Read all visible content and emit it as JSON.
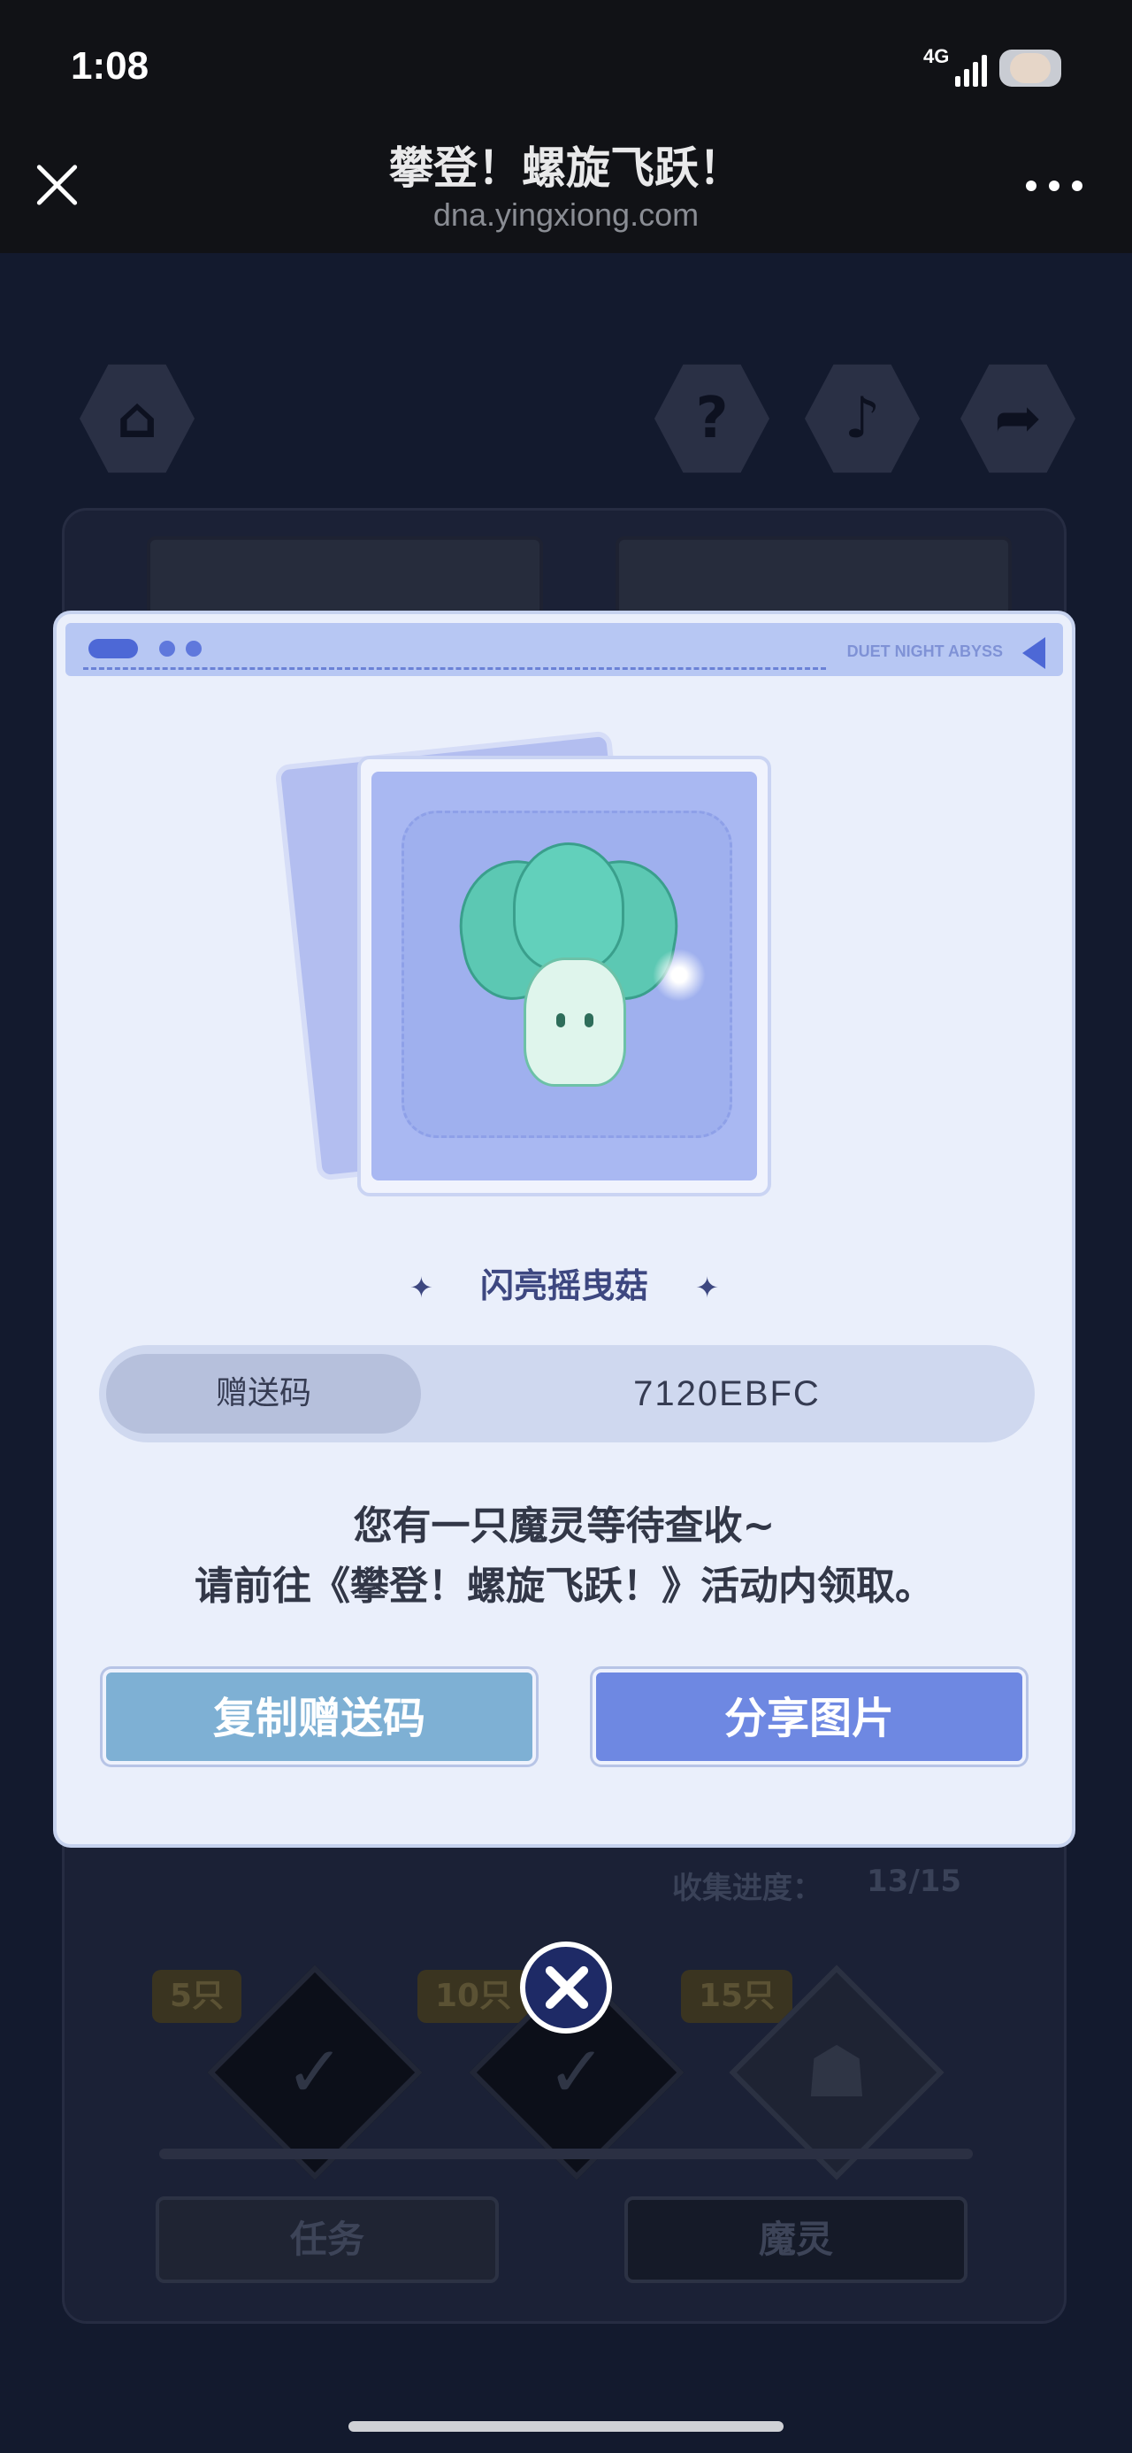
{
  "status_bar": {
    "time": "1:08",
    "network": "4G"
  },
  "header": {
    "title": "攀登！螺旋飞跃！",
    "url": "dna.yingxiong.com"
  },
  "game_bg": {
    "progress_label": "收集进度：",
    "progress_value": "13/15",
    "milestones": [
      "5只",
      "10只",
      "15只"
    ],
    "tabs": [
      "任务",
      "魔灵"
    ]
  },
  "modal": {
    "brand": "DUET NIGHT ABYSS",
    "monster_name": "闪亮摇曳菇",
    "code_label": "赠送码",
    "code_value": "7120EBFC",
    "message_line1": "您有一只魔灵等待查收~",
    "message_line2": "请前往《攀登！螺旋飞跃！》活动内领取。",
    "copy_button": "复制赠送码",
    "share_button": "分享图片"
  },
  "colors": {
    "modal_bg": "#eaeffb",
    "copy_button": "#7eb0d4",
    "share_button": "#6e88e2",
    "accent": "#4d68d6"
  }
}
